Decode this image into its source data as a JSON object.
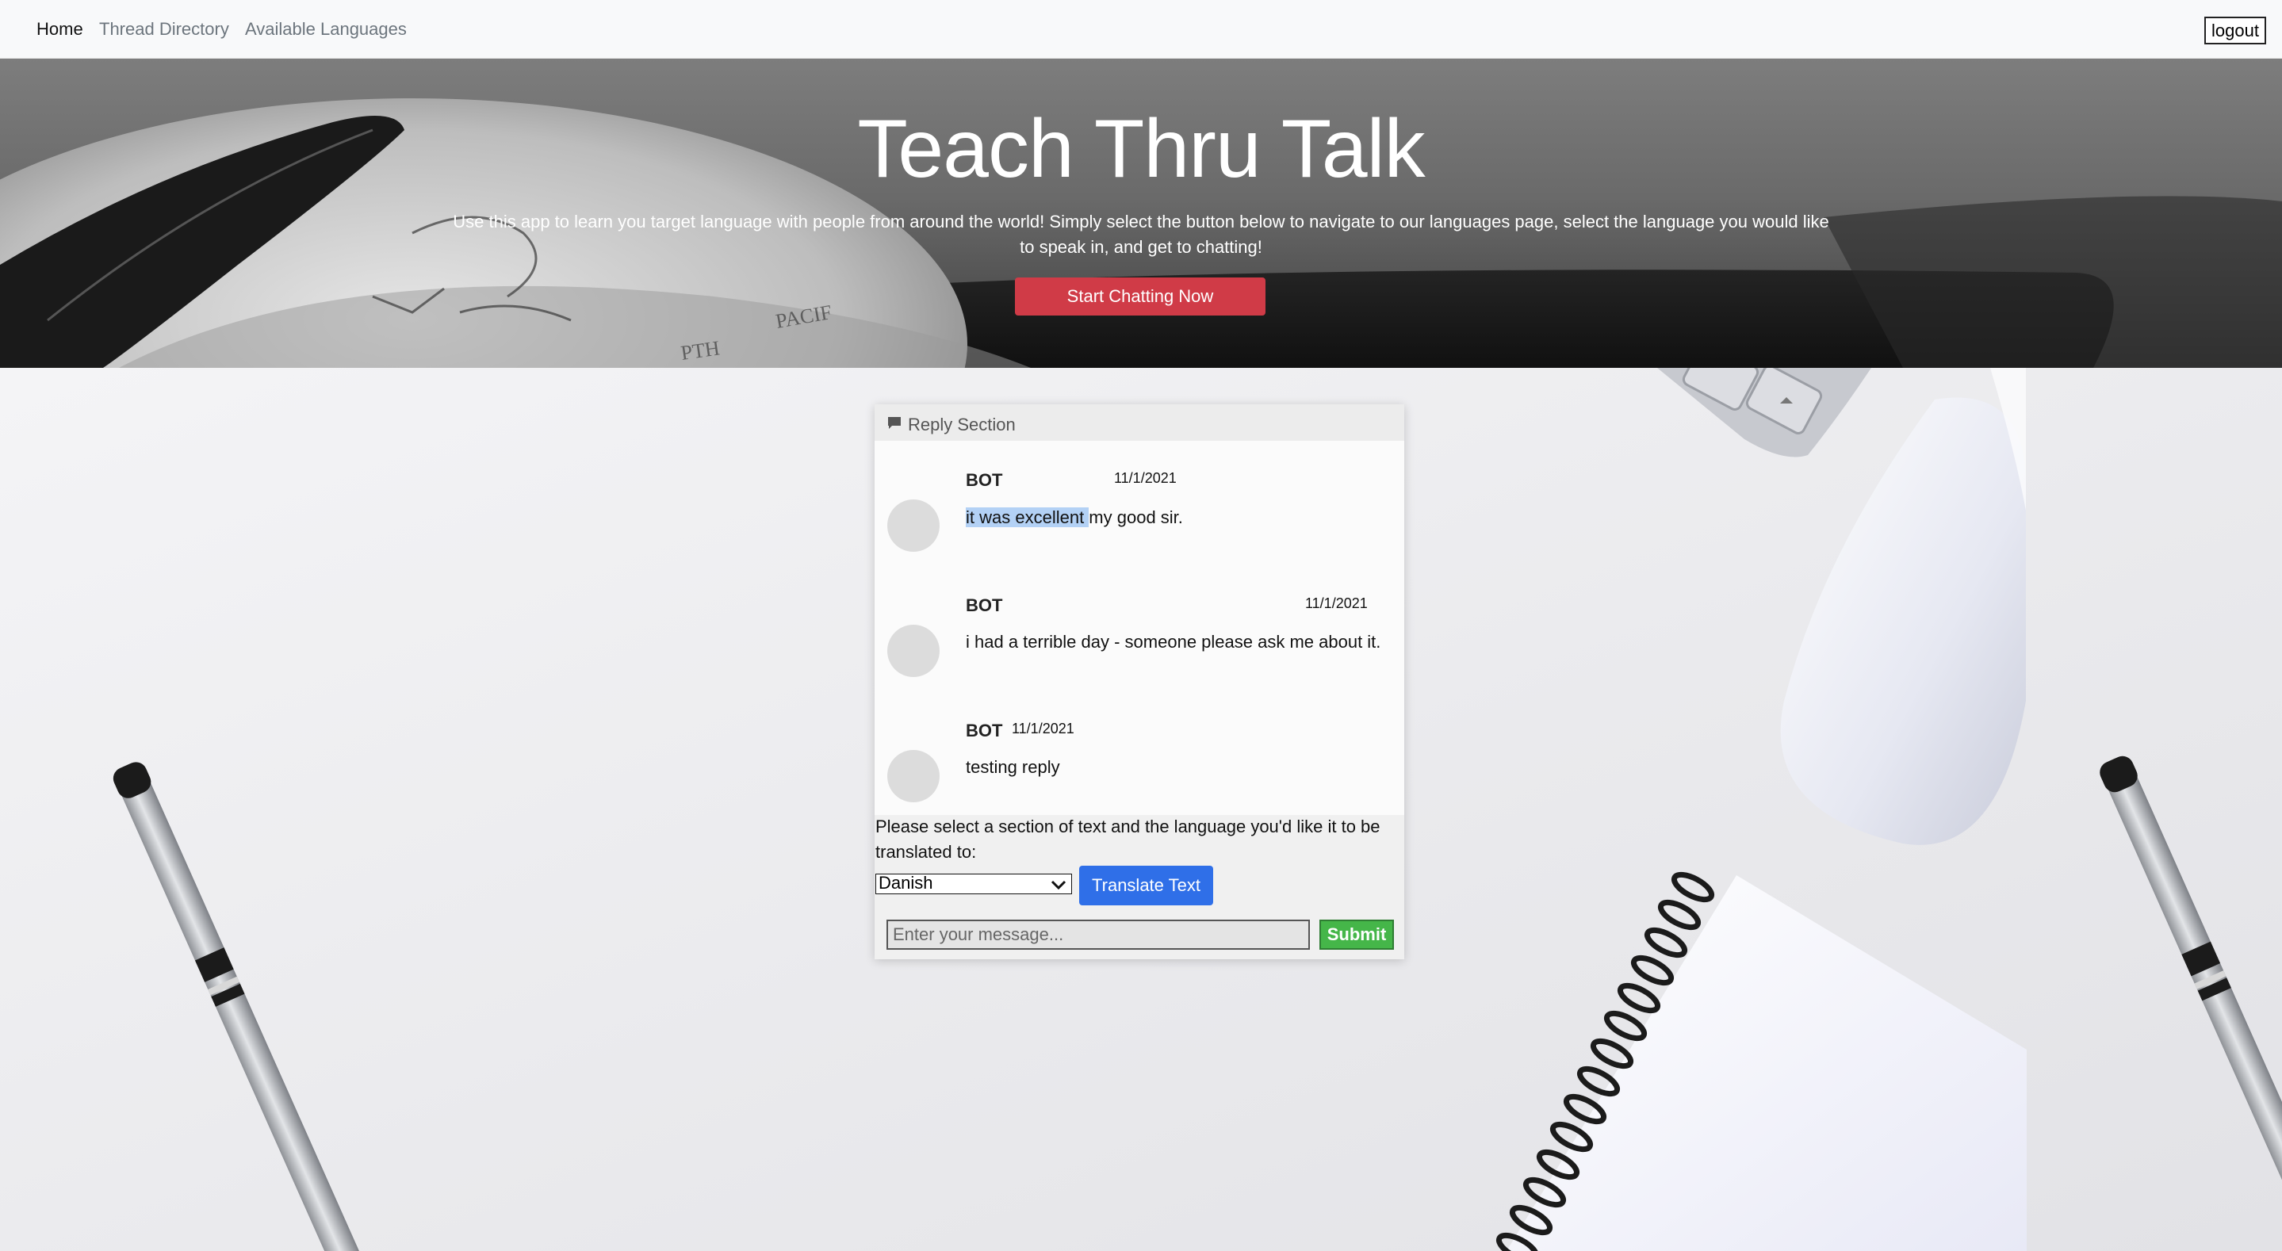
{
  "nav": {
    "items": [
      {
        "label": "Home",
        "active": true
      },
      {
        "label": "Thread Directory",
        "active": false
      },
      {
        "label": "Available Languages",
        "active": false
      }
    ],
    "logout_label": "logout"
  },
  "hero": {
    "title": "Teach Thru Talk",
    "description": "Use this app to learn you target language with people from around the world! Simply select the button below to navigate to our languages page, select the language you would like to speak in, and get to chatting!",
    "cta_label": "Start Chatting Now"
  },
  "reply_section": {
    "header_icon": "comment-icon",
    "title": "Reply Section",
    "messages": [
      {
        "author": "BOT",
        "date": "11/1/2021",
        "text_highlighted": "it was excellent ",
        "text_rest": "my good sir."
      },
      {
        "author": "BOT",
        "date": "11/1/2021",
        "text": "i had a terrible day - someone please ask me about it."
      },
      {
        "author": "BOT",
        "date": "11/1/2021",
        "text": "testing reply"
      }
    ],
    "translate_prompt": "Please select a section of text and the language you'd like it to be translated to:",
    "language_selected": "Danish",
    "translate_label": "Translate Text",
    "message_placeholder": "Enter your message...",
    "submit_label": "Submit"
  },
  "colors": {
    "cta": "#d03b47",
    "translate_button": "#2f6fe8",
    "submit_button": "#45b649",
    "highlight": "#b3d1f5"
  }
}
